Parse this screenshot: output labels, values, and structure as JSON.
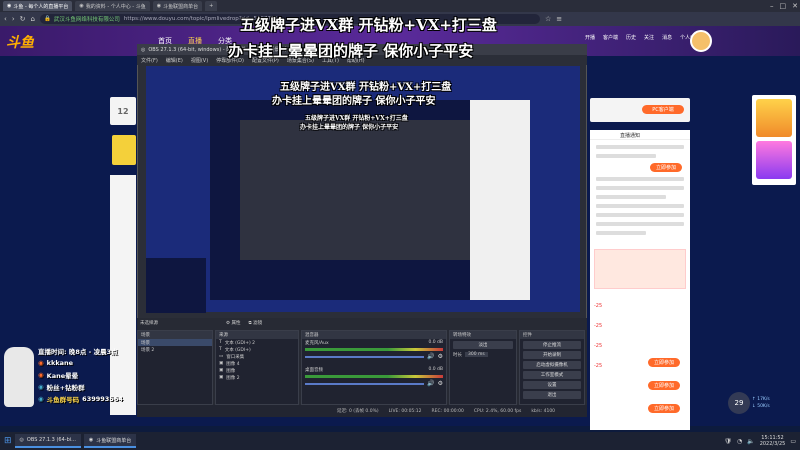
{
  "browser": {
    "tabs": [
      {
        "label": "斗鱼 - 每个人的直播平台"
      },
      {
        "label": "我的资料 - 个人中心 - 斗鱼"
      },
      {
        "label": "斗鱼联盟商单台"
      }
    ],
    "url": "https://www.douyu.com/topic/lpmlivedrop?rid=5507711",
    "site_label": "武汉斗鱼网络科技有限公司"
  },
  "site": {
    "logo": "斗鱼",
    "nav": [
      "首页",
      "直播",
      "分类"
    ],
    "right_nav": [
      "开播",
      "客户端",
      "历史",
      "关注",
      "消息",
      "个人中心"
    ],
    "number_badge": "12",
    "pc_client_label": "PC客户端",
    "live_mgmt_label": "直播通知",
    "follow_label": "万贯关注",
    "follow_btn": "立即参加",
    "viewers": "29",
    "upload_speed": "17K/s",
    "download_speed": "50K/s",
    "rank_values": [
      "-25",
      "-25",
      "-25",
      "-25"
    ]
  },
  "overlay": {
    "line1": "五级牌子进VX群  开钻粉+VX+打三盘",
    "line2": "办卡挂上晕晕团的牌子 保你小子平安"
  },
  "obs": {
    "title": "OBS 27.1.3 (64-bit, windows) - 配置文件: 未命名 - 场景: 未命名",
    "menu": [
      "文件(F)",
      "编辑(E)",
      "视图(V)",
      "停靠部件(D)",
      "配置文件(P)",
      "场景集合(S)",
      "工具(T)",
      "帮助(H)"
    ],
    "status_bar_label": "未选择源",
    "properties_btn": "属性",
    "filters_btn": "滤镜",
    "docks": {
      "scenes": {
        "title": "场景",
        "items": [
          "场景",
          "场景 2"
        ]
      },
      "sources": {
        "title": "来源",
        "items": [
          "文本 (GDI+) 2",
          "文本 (GDI+)",
          "窗口采集",
          "图像 4",
          "图像",
          "图像 2"
        ]
      },
      "mixer": {
        "title": "混音器",
        "channels": [
          {
            "name": "麦克风/Aux",
            "db": "0.0 dB"
          },
          {
            "name": "桌面音频",
            "db": "0.0 dB"
          }
        ]
      },
      "transitions": {
        "title": "转场特效",
        "type": "淡出",
        "duration_label": "时长",
        "duration": "300 ms"
      },
      "controls": {
        "title": "控件",
        "buttons": [
          "停止推流",
          "开始录制",
          "启动虚拟摄像机",
          "工作室模式",
          "设置",
          "退出"
        ]
      }
    },
    "status": {
      "live": "LIVE: 00:05:12",
      "rec": "REC: 00:00:00",
      "cpu": "CPU: 2.4%, 60.00 fps",
      "kbps": "kb/s: 4100",
      "stats_label": "延迟: 0 (丢帧 0.0%)"
    }
  },
  "streamer_card": {
    "title": "直播时间: 晚8点 - 凌晨3点",
    "name": "kkkane",
    "handle": "Kane晕晕",
    "fans": "粉丝+钻粉群",
    "group_label": "斗鱼群号码",
    "group_number": "639993564"
  },
  "taskbar": {
    "items": [
      "OBS 27.1.3 (64-bi...",
      "斗鱼联盟商单台"
    ],
    "time": "15:11:52",
    "date": "2022/3/25"
  },
  "colors": {
    "accent": "#ff6a2a",
    "brand": "#ffb000",
    "obs_bg": "#2b2e38"
  }
}
